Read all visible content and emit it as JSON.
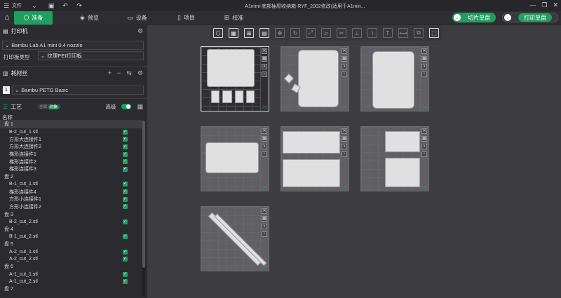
{
  "titlebar": {
    "menu_label": "文件",
    "title": "A1mini-底部抽屉收纳箱-RYF_2002修改(适用于A1min..."
  },
  "tabs": [
    {
      "label": "准备"
    },
    {
      "label": "预览"
    },
    {
      "label": "设备"
    },
    {
      "label": "项目"
    },
    {
      "label": "校准"
    }
  ],
  "actions": {
    "slice": "切片单盘",
    "print": "打印单盘"
  },
  "printer": {
    "section": "打印机",
    "model": "Bambu Lab A1 mini 0.4 nozzle",
    "plate_type_label": "打印板类型",
    "plate_type": "纹理PEI打印板"
  },
  "filament": {
    "section": "耗材丝",
    "slot": "1",
    "name": "Bambu PETG Basic"
  },
  "process": {
    "section": "工艺",
    "global": "全局",
    "object": "对象",
    "advanced": "高级"
  },
  "tree": {
    "header": "名称",
    "rows": [
      {
        "label": "盘 1",
        "indent": 0,
        "check": false
      },
      {
        "label": "B-2_cut_1.stl",
        "indent": 1,
        "check": true
      },
      {
        "label": "方形大连接件1",
        "indent": 1,
        "check": true
      },
      {
        "label": "方形大连接件2",
        "indent": 1,
        "check": true
      },
      {
        "label": "梯形连接件1",
        "indent": 1,
        "check": true
      },
      {
        "label": "梯形连接件2",
        "indent": 1,
        "check": true
      },
      {
        "label": "梯形连接件3",
        "indent": 1,
        "check": true
      },
      {
        "label": "盘 2",
        "indent": 0,
        "check": false
      },
      {
        "label": "B-1_cut_1.stl",
        "indent": 1,
        "check": true
      },
      {
        "label": "梯形连接件4",
        "indent": 1,
        "check": true
      },
      {
        "label": "方形小连接件1",
        "indent": 1,
        "check": true
      },
      {
        "label": "方形小连接件2",
        "indent": 1,
        "check": true
      },
      {
        "label": "盘 3",
        "indent": 0,
        "check": false
      },
      {
        "label": "B-2_cut_2.stl",
        "indent": 1,
        "check": true
      },
      {
        "label": "盘 4",
        "indent": 0,
        "check": false
      },
      {
        "label": "B-1_cut_2.stl",
        "indent": 1,
        "check": true
      },
      {
        "label": "盘 5",
        "indent": 0,
        "check": false
      },
      {
        "label": "A-2_cut_1.stl",
        "indent": 1,
        "check": true
      },
      {
        "label": "A-2_cut_2.stl",
        "indent": 1,
        "check": true
      },
      {
        "label": "盘 6",
        "indent": 0,
        "check": false
      },
      {
        "label": "A-1_cut_1.stl",
        "indent": 1,
        "check": true
      },
      {
        "label": "A-1_cut_2.stl",
        "indent": 1,
        "check": true
      },
      {
        "label": "盘 7",
        "indent": 0,
        "check": false
      }
    ]
  },
  "plates": [
    {
      "num": "01"
    },
    {
      "num": "02"
    },
    {
      "num": "03"
    },
    {
      "num": "04"
    },
    {
      "num": "05"
    },
    {
      "num": "06"
    },
    {
      "num": "07"
    }
  ]
}
